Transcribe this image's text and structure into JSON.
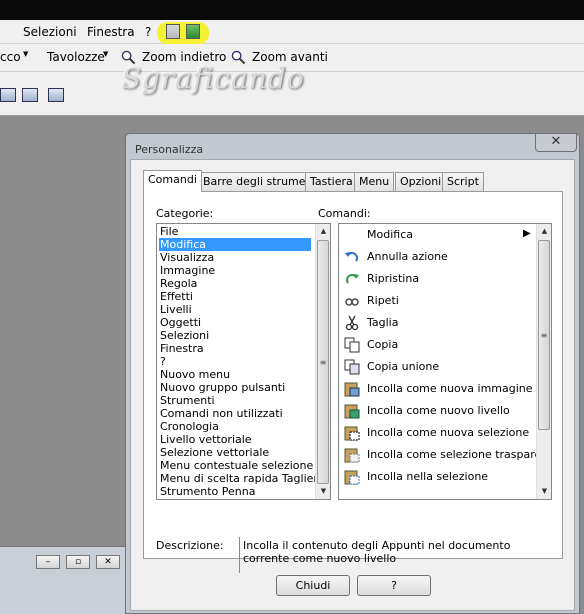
{
  "menubar": {
    "items": [
      "Selezioni",
      "Finestra",
      "?"
    ]
  },
  "toolbar": {
    "items": [
      "cco",
      "Tavolozze",
      "Zoom indietro",
      "Zoom avanti"
    ]
  },
  "watermark": "Sgraficando",
  "dialog": {
    "title": "Personalizza",
    "close_glyph": "✕",
    "tabs": [
      "Comandi",
      "Barre degli strumenti",
      "Tastiera",
      "Menu",
      "Opzioni",
      "Script"
    ],
    "categories_label": "Categorie:",
    "commands_label": "Comandi:",
    "categories": [
      "File",
      "Modifica",
      "Visualizza",
      "Immagine",
      "Regola",
      "Effetti",
      "Livelli",
      "Oggetti",
      "Selezioni",
      "Finestra",
      "?",
      "Nuovo menu",
      "Nuovo gruppo pulsanti",
      "Strumenti",
      "Comandi non utilizzati",
      "Cronologia",
      "Livello vettoriale",
      "Selezione vettoriale",
      "Menu contestuale selezione rast",
      "Menu di scelta rapida Taglierina",
      "Strumento Penna"
    ],
    "selected_category": "Modifica",
    "commands": [
      {
        "label": "Modifica",
        "icon": "none"
      },
      {
        "label": "Annulla azione",
        "icon": "undo-icon"
      },
      {
        "label": "Ripristina",
        "icon": "redo-icon"
      },
      {
        "label": "Ripeti",
        "icon": "repeat-icon"
      },
      {
        "label": "Taglia",
        "icon": "scissors-icon"
      },
      {
        "label": "Copia",
        "icon": "copy-icon"
      },
      {
        "label": "Copia unione",
        "icon": "copy-merge-icon"
      },
      {
        "label": "Incolla come nuova immagine",
        "icon": "paste-image-icon"
      },
      {
        "label": "Incolla come nuovo livello",
        "icon": "paste-layer-icon"
      },
      {
        "label": "Incolla come nuova selezione",
        "icon": "paste-selection-icon"
      },
      {
        "label": "Incolla come selezione trasparente",
        "icon": "paste-transparent-icon"
      },
      {
        "label": "Incolla nella selezione",
        "icon": "paste-into-icon"
      }
    ],
    "description_label": "Descrizione:",
    "description": "Incolla il contenuto degli Appunti nel documento corrente come nuovo livello",
    "buttons": {
      "close": "Chiudi",
      "help": "?"
    }
  },
  "colors": {
    "highlight": "#f4f232",
    "selection": "#3399ff"
  }
}
